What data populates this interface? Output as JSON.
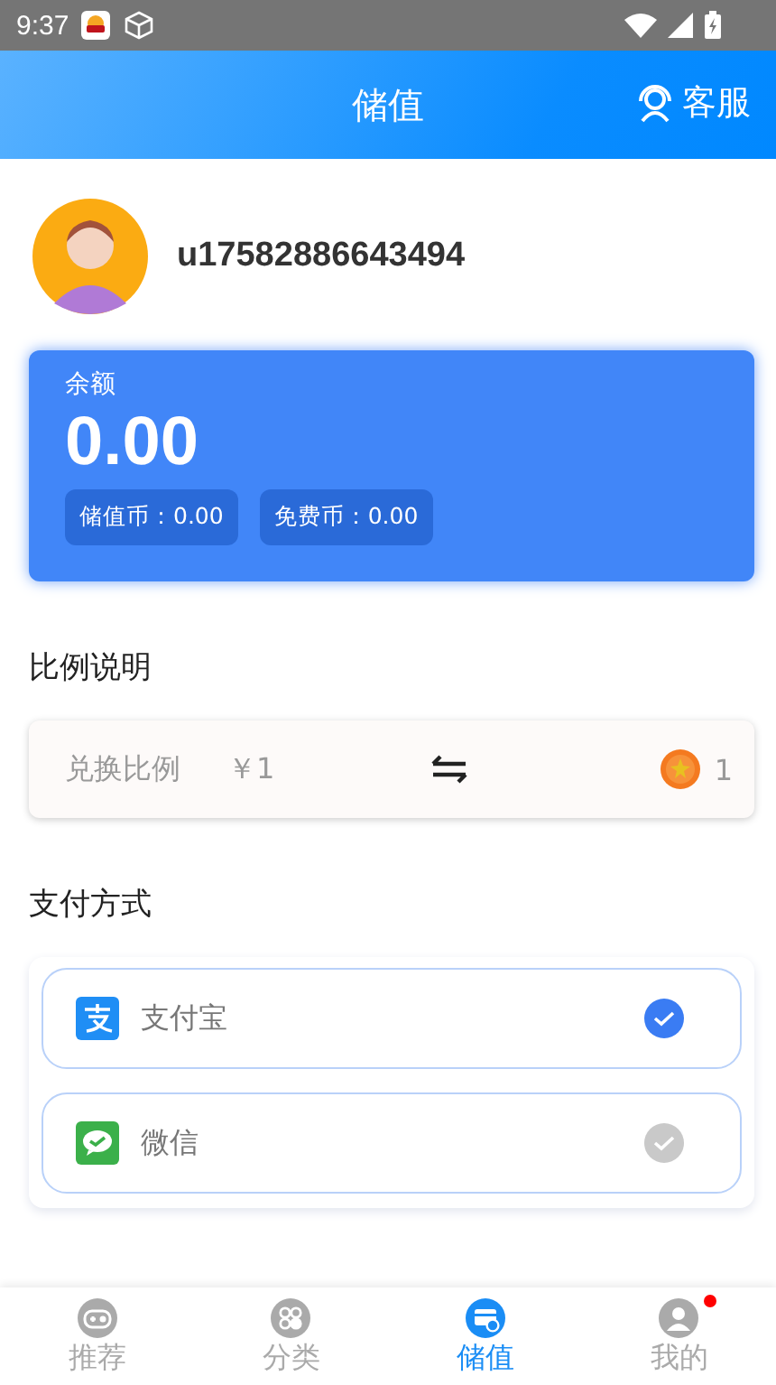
{
  "status_bar": {
    "time": "9:37"
  },
  "header": {
    "title": "储值",
    "service": "客服"
  },
  "user": {
    "name": "u17582886643494"
  },
  "balance": {
    "label": "余额",
    "amount": "0.00",
    "chips": [
      "储值币：0.00",
      "免费币：0.00"
    ]
  },
  "ratio": {
    "heading": "比例说明",
    "label": "兑换比例",
    "from": "￥1",
    "to": "1"
  },
  "payment": {
    "heading": "支付方式",
    "methods": [
      {
        "kind": "alipay",
        "label": "支付宝",
        "selected": true
      },
      {
        "kind": "wechat",
        "label": "微信",
        "selected": false
      }
    ]
  },
  "tabs": [
    {
      "kind": "game",
      "label": "推荐",
      "selected": false,
      "dot": false
    },
    {
      "kind": "category",
      "label": "分类",
      "selected": false,
      "dot": false
    },
    {
      "kind": "wallet",
      "label": "储值",
      "selected": true,
      "dot": false
    },
    {
      "kind": "user",
      "label": "我的",
      "selected": false,
      "dot": true
    }
  ]
}
